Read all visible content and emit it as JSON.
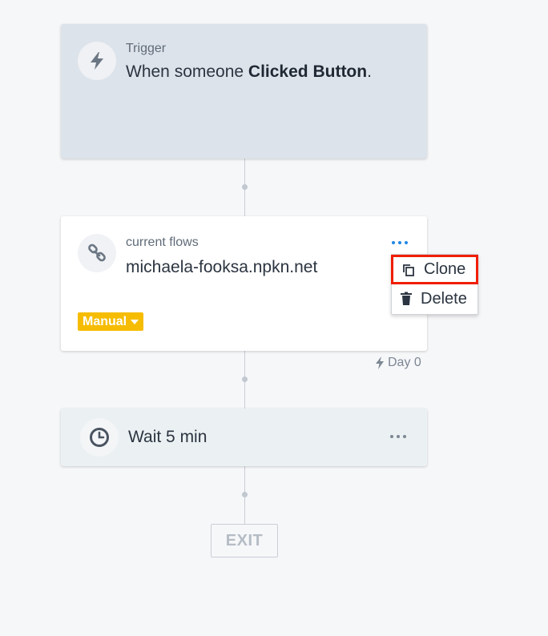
{
  "trigger": {
    "label": "Trigger",
    "prefix": "When someone ",
    "event": "Clicked Button",
    "suffix": "."
  },
  "flow": {
    "label": "current flows",
    "name": "michaela-fooksa.npkn.net",
    "badge": "Manual"
  },
  "context_menu": {
    "clone_label": "Clone",
    "delete_label": "Delete"
  },
  "day_label": "Day 0",
  "wait": {
    "label": "Wait 5 min"
  },
  "exit_label": "EXIT",
  "colors": {
    "trigger_card": "#dde3ea",
    "badge": "#f6bc00",
    "highlight": "#f01e00",
    "menu_dots_active": "#1e88e5"
  },
  "icons": {
    "trigger": "lightning-icon",
    "flow": "link-icon",
    "wait": "clock-icon",
    "clone": "copy-icon",
    "delete": "trash-icon"
  }
}
